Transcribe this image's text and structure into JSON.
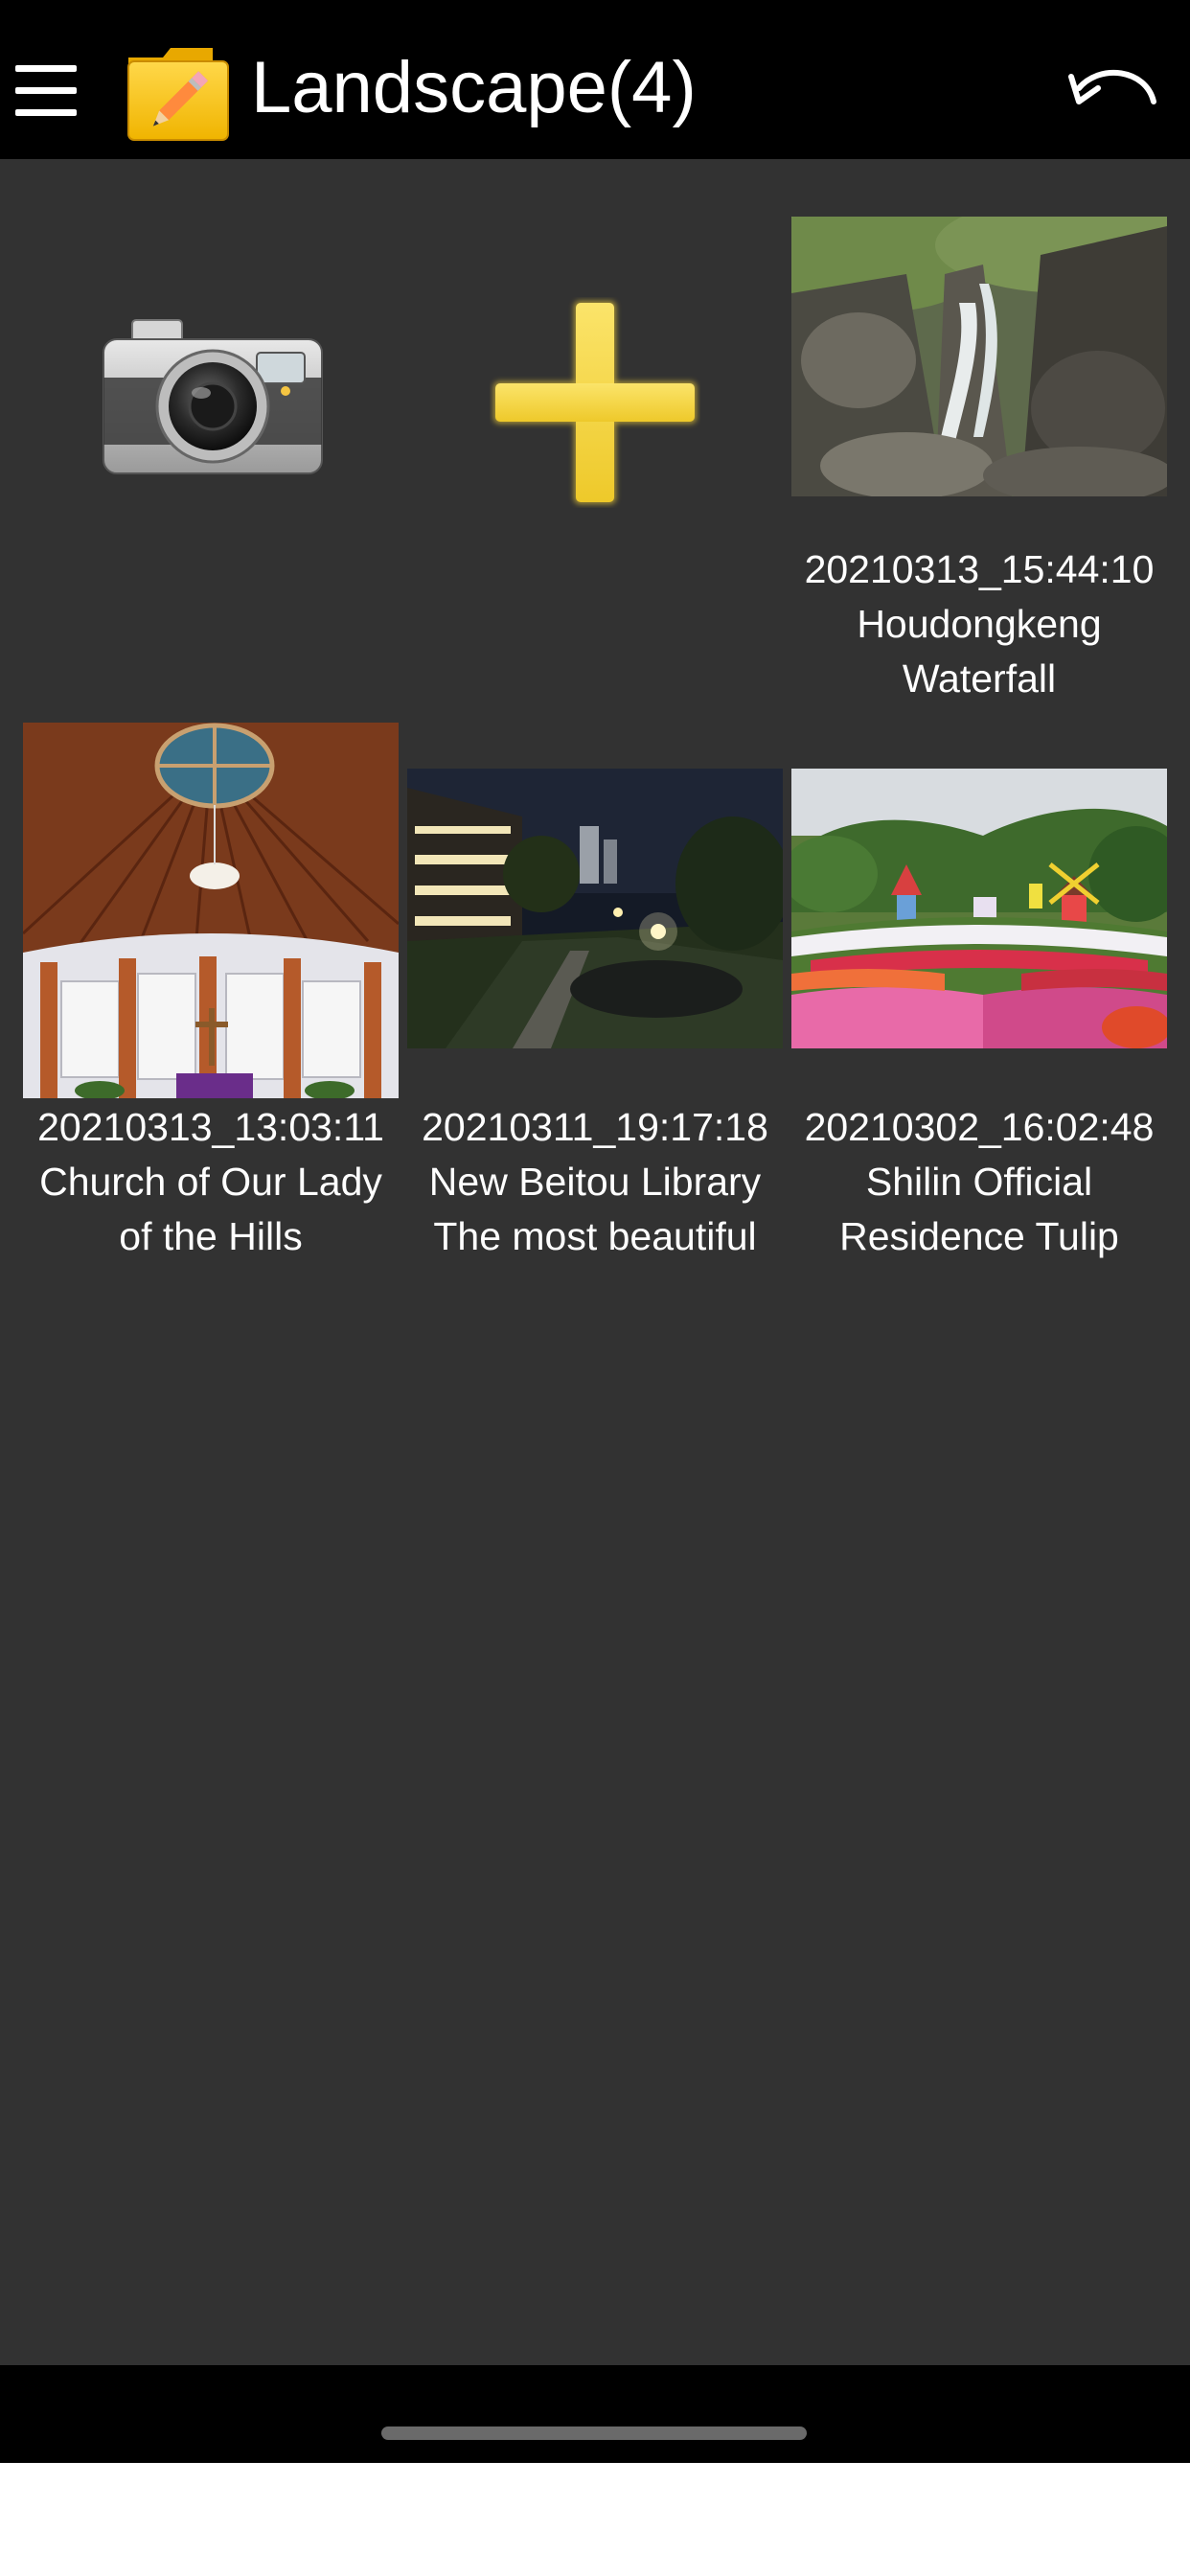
{
  "header": {
    "title": "Landscape(4)",
    "menu_icon": "hamburger-menu-icon",
    "folder_icon": "folder-pencil-icon",
    "back_icon": "undo-arrow-icon"
  },
  "grid": {
    "actions": [
      {
        "name": "camera",
        "icon": "camera-icon"
      },
      {
        "name": "add",
        "icon": "plus-icon",
        "color": "#f5d33a"
      }
    ],
    "items": [
      {
        "timestamp": "20210313_15:44:10",
        "line1": "Houdongkeng",
        "line2": "Waterfall"
      },
      {
        "timestamp": "20210313_13:03:11",
        "line1": "Church of Our Lady",
        "line2": "of the Hills"
      },
      {
        "timestamp": "20210311_19:17:18",
        "line1": "New Beitou Library",
        "line2": "The most beautiful"
      },
      {
        "timestamp": "20210302_16:02:48",
        "line1": "Shilin Official",
        "line2": "Residence Tulip"
      }
    ]
  },
  "colors": {
    "background": "#323232",
    "bar": "#000000",
    "accent_yellow": "#f5d33a"
  }
}
